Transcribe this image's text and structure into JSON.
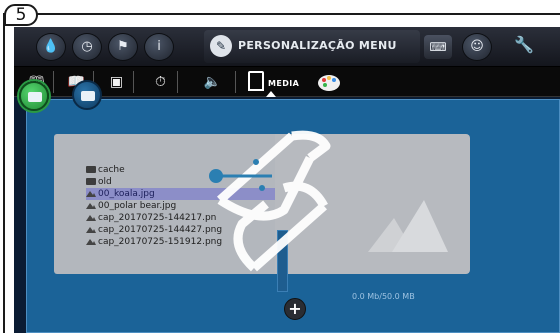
{
  "step": {
    "number": "5"
  },
  "topbar": {
    "title": "PERSONALIZAÇÃO MENU",
    "icons": [
      "water-drop-icon",
      "clock-icon",
      "flag-icon",
      "info-icon",
      "pen-icon",
      "keyboard-icon",
      "user-icon",
      "wrench-icon"
    ]
  },
  "subbar": {
    "media_label": "MEDIA",
    "icons": [
      "book-icon",
      "book-open-icon",
      "picture-icon",
      "timer-icon",
      "speaker-icon",
      "media-icon",
      "palette-icon"
    ]
  },
  "files": [
    {
      "name": "cache",
      "type": "folder",
      "selected": false
    },
    {
      "name": "old",
      "type": "folder",
      "selected": false
    },
    {
      "name": "00_koala.jpg",
      "type": "image",
      "selected": true
    },
    {
      "name": "00_polar bear.jpg",
      "type": "image",
      "selected": false
    },
    {
      "name": "cap_20170725-144217.pn",
      "type": "image",
      "selected": false
    },
    {
      "name": "cap_20170725-144427.png",
      "type": "image",
      "selected": false
    },
    {
      "name": "cap_20170725-151912.png",
      "type": "image",
      "selected": false
    }
  ],
  "storage": "0.0 Mb/50.0 MB",
  "colors": {
    "panel": "#1b6398",
    "selection": "#8c8ec8",
    "accent_green": "#2a9a44",
    "wrench": "#f2c04a"
  }
}
